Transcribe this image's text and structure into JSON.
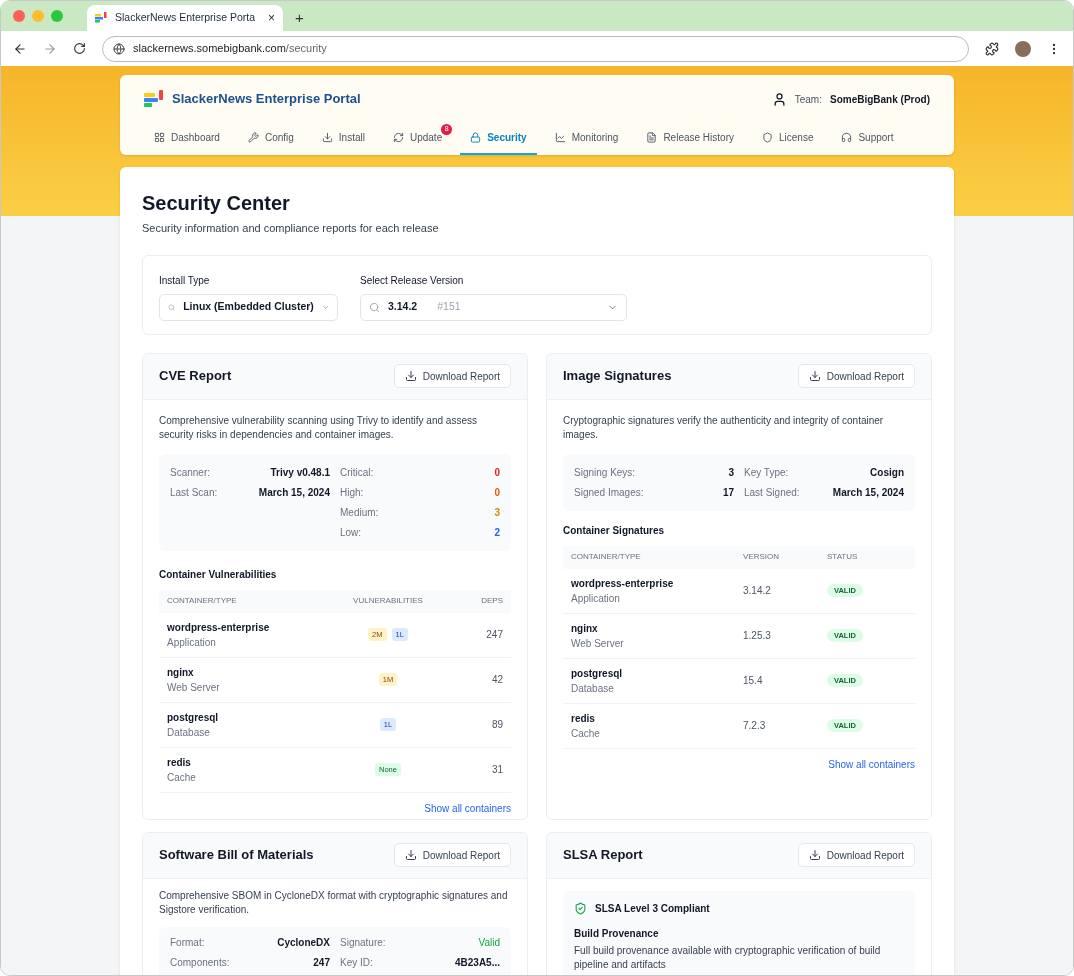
{
  "browser": {
    "tab_title": "SlackerNews Enterprise Porta",
    "close": "×",
    "new_tab": "+",
    "url_host": "slackernews.somebigbank.com",
    "url_path": "/security"
  },
  "header": {
    "title": "SlackerNews Enterprise Portal",
    "team_label": "Team:",
    "team": "SomeBigBank (Prod)"
  },
  "nav": [
    {
      "label": "Dashboard",
      "selected": false
    },
    {
      "label": "Config",
      "selected": false
    },
    {
      "label": "Install",
      "selected": false
    },
    {
      "label": "Update",
      "selected": false,
      "badge": "8"
    },
    {
      "label": "Security",
      "selected": true
    },
    {
      "label": "Monitoring",
      "selected": false
    },
    {
      "label": "Release History",
      "selected": false
    },
    {
      "label": "License",
      "selected": false
    },
    {
      "label": "Support",
      "selected": false
    }
  ],
  "page": {
    "title": "Security Center",
    "subtitle": "Security information and compliance reports for each release"
  },
  "filters": [
    {
      "label": "Install Type",
      "value": "Linux (Embedded Cluster)"
    },
    {
      "label": "Select Release Version",
      "value": "3.14.2",
      "hint": "#151"
    }
  ],
  "cve": {
    "title": "CVE Report",
    "button": "Download Report",
    "description": "Comprehensive vulnerability scanning using Trivy to identify and assess security risks in dependencies and container images.",
    "stats": [
      {
        "label": "Scanner:",
        "value": "Trivy v0.48.1"
      },
      {
        "label": "Last Scan:",
        "value": "March 15, 2024"
      }
    ],
    "severity": [
      {
        "label": "Critical:",
        "value": "0",
        "color": "#dc2626"
      },
      {
        "label": "High:",
        "value": "0",
        "color": "#ea580c"
      },
      {
        "label": "Medium:",
        "value": "3",
        "color": "#ca8a04"
      },
      {
        "label": "Low:",
        "value": "2",
        "color": "#2563eb"
      }
    ],
    "table_title": "Container Vulnerabilities",
    "columns": [
      "CONTAINER/TYPE",
      "VULNERABILITIES",
      "DEPS"
    ],
    "rows": [
      {
        "name": "wordpress-enterprise",
        "type": "Application",
        "badges": [
          {
            "text": "2M",
            "kind": "medium"
          },
          {
            "text": "1L",
            "kind": "low"
          }
        ],
        "deps": "247"
      },
      {
        "name": "nginx",
        "type": "Web Server",
        "badges": [
          {
            "text": "1M",
            "kind": "medium"
          }
        ],
        "deps": "42"
      },
      {
        "name": "postgresql",
        "type": "Database",
        "badges": [
          {
            "text": "1L",
            "kind": "low"
          }
        ],
        "deps": "89"
      },
      {
        "name": "redis",
        "type": "Cache",
        "badges": [
          {
            "text": "None",
            "kind": "none"
          }
        ],
        "deps": "31"
      }
    ],
    "link": "Show all containers"
  },
  "signatures": {
    "title": "Image Signatures",
    "button": "Download Report",
    "description": "Cryptographic signatures verify the authenticity and integrity of container images.",
    "stats_left": [
      {
        "label": "Signing Keys:",
        "value": "3"
      },
      {
        "label": "Signed Images:",
        "value": "17"
      }
    ],
    "stats_right": [
      {
        "label": "Key Type:",
        "value": "Cosign"
      },
      {
        "label": "Last Signed:",
        "value": "March 15, 2024"
      }
    ],
    "table_title": "Container Signatures",
    "columns": [
      "CONTAINER/TYPE",
      "VERSION",
      "STATUS"
    ],
    "rows": [
      {
        "name": "wordpress-enterprise",
        "type": "Application",
        "version": "3.14.2",
        "status": "VALID"
      },
      {
        "name": "nginx",
        "type": "Web Server",
        "version": "1.25.3",
        "status": "VALID"
      },
      {
        "name": "postgresql",
        "type": "Database",
        "version": "15.4",
        "status": "VALID"
      },
      {
        "name": "redis",
        "type": "Cache",
        "version": "7.2.3",
        "status": "VALID"
      }
    ],
    "link": "Show all containers"
  },
  "sbom": {
    "title": "Software Bill of Materials",
    "button": "Download Report",
    "description": "Comprehensive SBOM in CycloneDX format with cryptographic signatures and Sigstore verification.",
    "stats_left": [
      {
        "label": "Format:",
        "value": "CycloneDX",
        "kind": "plain"
      },
      {
        "label": "Components:",
        "value": "247",
        "kind": "plain"
      }
    ],
    "stats_right": [
      {
        "label": "Signature:",
        "value": "Valid",
        "kind": "status"
      },
      {
        "label": "Key ID:",
        "value": "4B23A5...",
        "kind": "plain"
      }
    ]
  },
  "slsa": {
    "title": "SLSA Report",
    "button": "Download Report",
    "badge": "SLSA Level 3 Compliant",
    "section_title": "Build Provenance",
    "section_text": "Full build provenance available with cryptographic verification of build pipeline and artifacts"
  }
}
